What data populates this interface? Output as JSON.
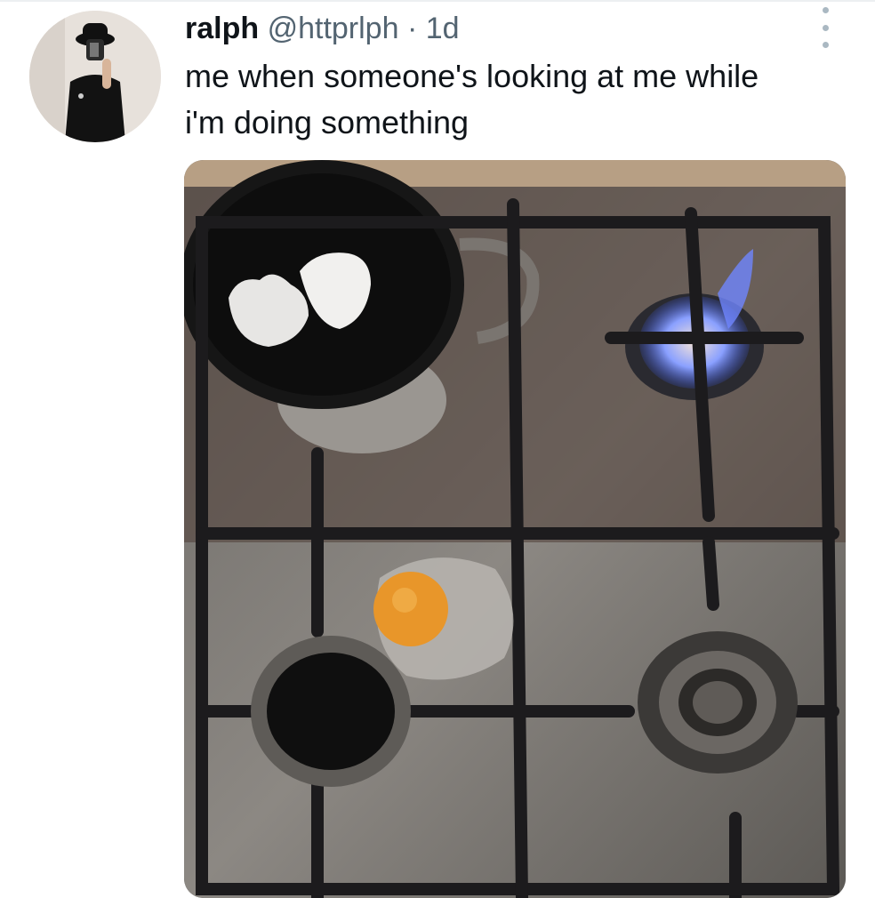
{
  "tweet": {
    "author_name": "ralph",
    "author_handle": "@httprlph",
    "separator": "·",
    "timestamp": "1d",
    "text_lines": [
      "me when someone's looking at me while",
      "i'm doing something"
    ]
  },
  "icons": {
    "more": "more-vertical-icon"
  },
  "colors": {
    "text": "#0f1419",
    "muted": "#536471",
    "flame": "#5b7cff",
    "yolk": "#e8962a"
  }
}
